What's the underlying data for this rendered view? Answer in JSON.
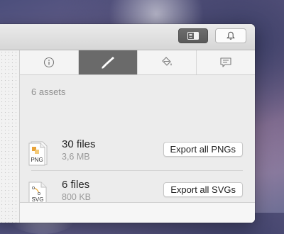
{
  "inspector": {
    "tabs": [
      {
        "id": "info",
        "icon": "info-icon",
        "active": false
      },
      {
        "id": "export",
        "icon": "knife-icon",
        "active": true
      },
      {
        "id": "style",
        "icon": "paint-bucket-icon",
        "active": false
      },
      {
        "id": "comments",
        "icon": "comment-icon",
        "active": false
      }
    ],
    "section_title": "6 assets",
    "assets": [
      {
        "format_badge": "PNG",
        "count": "30 files",
        "size": "3,6 MB",
        "button_label": "Export all PNGs"
      },
      {
        "format_badge": "SVG",
        "count": "6 files",
        "size": "800 KB",
        "button_label": "Export all SVGs"
      }
    ]
  },
  "toolbar": {
    "buttons": [
      {
        "id": "toggle-panel",
        "icon": "sidebar-panel-icon",
        "active": true
      },
      {
        "id": "notifications",
        "icon": "bell-icon",
        "active": false
      }
    ]
  },
  "colors": {
    "active_tab": "#6a6a6a",
    "png_accent": "#e8a33a",
    "svg_accent": "#f0b040"
  }
}
